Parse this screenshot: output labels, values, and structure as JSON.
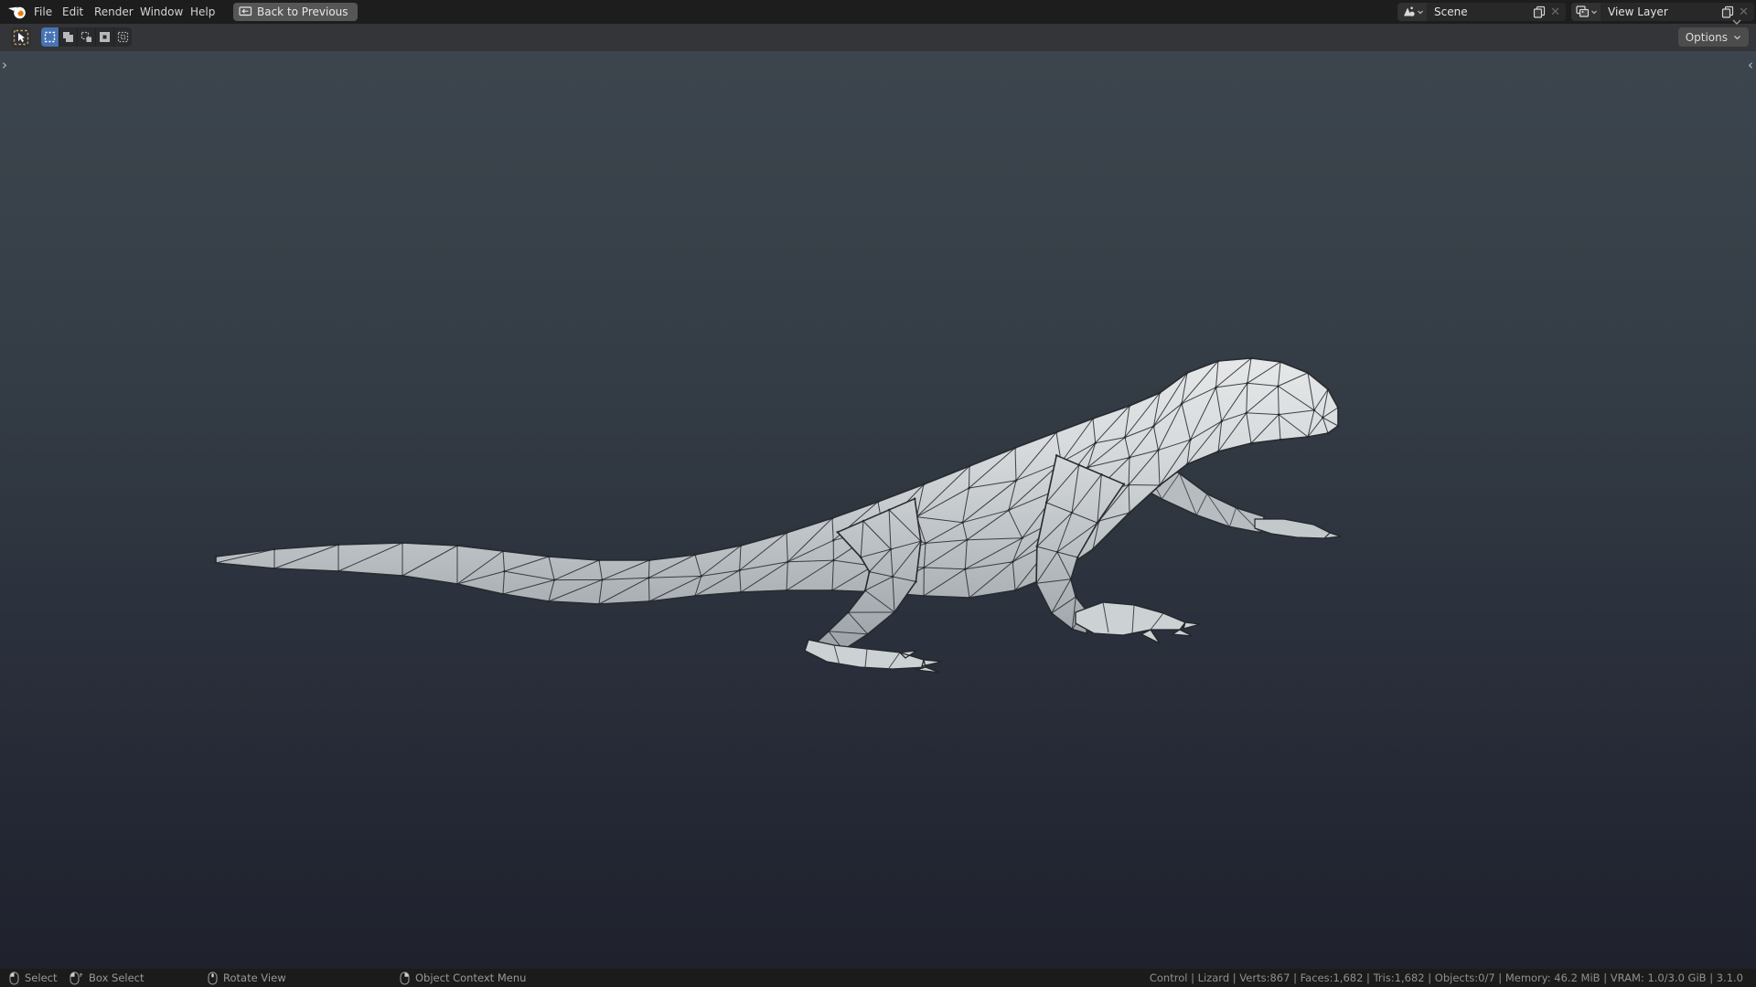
{
  "menubar": {
    "items": [
      {
        "label": "File"
      },
      {
        "label": "Edit"
      },
      {
        "label": "Render"
      },
      {
        "label": "Window"
      },
      {
        "label": "Help"
      }
    ],
    "back_button_label": "Back to Previous",
    "scene_selector": {
      "value": "Scene"
    },
    "view_layer_selector": {
      "value": "View Layer"
    }
  },
  "tool_header": {
    "options_label": "Options",
    "active_tool": "select-box",
    "select_modes": [
      {
        "name": "set",
        "active": true
      },
      {
        "name": "extend",
        "active": false
      },
      {
        "name": "subtract",
        "active": false
      },
      {
        "name": "invert",
        "active": false
      },
      {
        "name": "intersect",
        "active": false
      }
    ]
  },
  "viewport": {
    "object_name": "Lizard",
    "display": "triangulated wireframe over shaded mesh",
    "colors": {
      "bg_top": "#3c454d",
      "bg_bottom": "#1f222d",
      "mesh_fill_light": "#e6e8e9",
      "mesh_fill_dark": "#969da3",
      "wire": "#2c2f33",
      "accent_blue": "#4772b3",
      "logo_orange": "#e87d0d"
    }
  },
  "statusbar": {
    "hints": [
      {
        "mouse": "left",
        "label": "Select"
      },
      {
        "mouse": "left-drag",
        "label": "Box Select"
      },
      {
        "mouse": "middle",
        "label": "Rotate View"
      },
      {
        "mouse": "right",
        "label": "Object Context Menu"
      }
    ],
    "stats": {
      "collection": "Control",
      "object": "Lizard",
      "verts": "867",
      "faces": "1,682",
      "tris": "1,682",
      "objects": "0/7",
      "memory": "46.2 MiB",
      "vram": "1.0/3.0 GiB",
      "version": "3.1.0",
      "line": "Control | Lizard | Verts:867 | Faces:1,682 | Tris:1,682 | Objects:0/7 | Memory: 46.2 MiB | VRAM: 1.0/3.0 GiB | 3.1.0"
    }
  }
}
